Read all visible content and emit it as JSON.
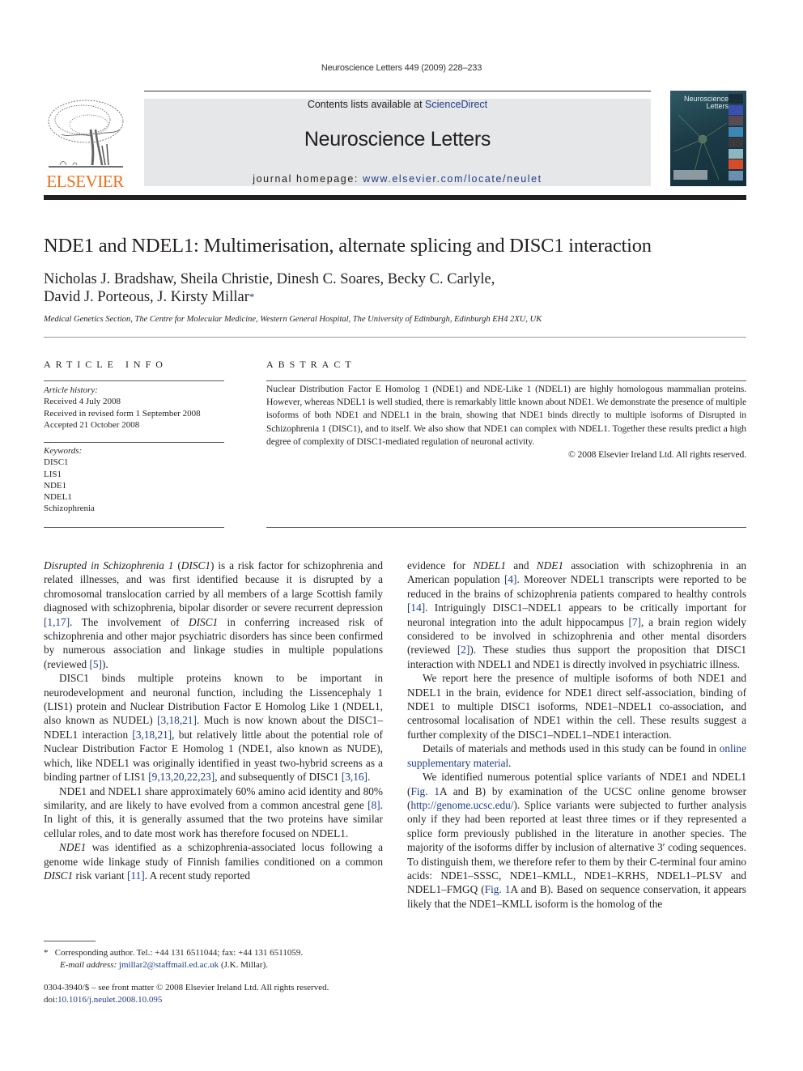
{
  "running_head": "Neuroscience Letters 449 (2009) 228–233",
  "masthead": {
    "publisher": "ELSEVIER",
    "contents_prefix": "Contents lists available at ",
    "contents_link": "ScienceDirect",
    "journal_title": "Neuroscience Letters",
    "homepage_prefix": "journal homepage: ",
    "homepage_link": "www.elsevier.com/locate/neulet",
    "cover_title_line1": "Neuroscience",
    "cover_title_line2": "Letters",
    "accent_color": "#1f3c88",
    "publisher_color": "#e9711c"
  },
  "article": {
    "title": "NDE1 and NDEL1: Multimerisation, alternate splicing and DISC1 interaction",
    "authors_line1": "Nicholas J. Bradshaw, Sheila Christie, Dinesh C. Soares, Becky C. Carlyle,",
    "authors_line2": "David J. Porteous, J. Kirsty Millar",
    "corresponding_marker": "*",
    "affiliation": "Medical Genetics Section, The Centre for Molecular Medicine, Western General Hospital, The University of Edinburgh, Edinburgh EH4 2XU, UK"
  },
  "article_info": {
    "heading": "ARTICLE INFO",
    "history_label": "Article history:",
    "history": [
      "Received 4 July 2008",
      "Received in revised form 1 September 2008",
      "Accepted 21 October 2008"
    ],
    "keywords_label": "Keywords:",
    "keywords": [
      "DISC1",
      "LIS1",
      "NDE1",
      "NDEL1",
      "Schizophrenia"
    ]
  },
  "abstract": {
    "heading": "ABSTRACT",
    "text": "Nuclear Distribution Factor E Homolog 1 (NDE1) and NDE-Like 1 (NDEL1) are highly homologous mammalian proteins. However, whereas NDEL1 is well studied, there is remarkably little known about NDE1. We demonstrate the presence of multiple isoforms of both NDE1 and NDEL1 in the brain, showing that NDE1 binds directly to multiple isoforms of Disrupted in Schizophrenia 1 (DISC1), and to itself. We also show that NDE1 can complex with NDEL1. Together these results predict a high degree of complexity of DISC1-mediated regulation of neuronal activity.",
    "copyright": "© 2008 Elsevier Ireland Ltd. All rights reserved."
  },
  "body": {
    "left": {
      "p1": [
        {
          "t": "Disrupted in Schizophrenia 1",
          "s": "i"
        },
        {
          "t": " ("
        },
        {
          "t": "DISC1",
          "s": "i"
        },
        {
          "t": ") is a risk factor for schizophrenia and related illnesses, and was first identified because it is disrupted by a chromosomal translocation carried by all members of a large Scottish family diagnosed with schizophrenia, bipolar disorder or severe recurrent depression "
        },
        {
          "t": "[1,17]",
          "s": "ref"
        },
        {
          "t": ". The involvement of "
        },
        {
          "t": "DISC1",
          "s": "i"
        },
        {
          "t": " in conferring increased risk of schizophrenia and other major psychiatric disorders has since been confirmed by numerous association and linkage studies in multiple populations (reviewed "
        },
        {
          "t": "[5]",
          "s": "ref"
        },
        {
          "t": ")."
        }
      ],
      "p2": [
        {
          "t": "DISC1 binds multiple proteins known to be important in neurodevelopment and neuronal function, including the Lissencephaly 1 (LIS1) protein and Nuclear Distribution Factor E Homolog Like 1 (NDEL1, also known as NUDEL) "
        },
        {
          "t": "[3,18,21]",
          "s": "ref"
        },
        {
          "t": ". Much is now known about the DISC1–NDEL1 interaction "
        },
        {
          "t": "[3,18,21]",
          "s": "ref"
        },
        {
          "t": ", but relatively little about the potential role of Nuclear Distribution Factor E Homolog 1 (NDE1, also known as NUDE), which, like NDEL1 was originally identified in yeast two-hybrid screens as a binding partner of LIS1 "
        },
        {
          "t": "[9,13,20,22,23]",
          "s": "ref"
        },
        {
          "t": ", and subsequently of DISC1 "
        },
        {
          "t": "[3,16]",
          "s": "ref"
        },
        {
          "t": "."
        }
      ],
      "p3": [
        {
          "t": "NDE1 and NDEL1 share approximately 60% amino acid identity and 80% similarity, and are likely to have evolved from a common ancestral gene "
        },
        {
          "t": "[8]",
          "s": "ref"
        },
        {
          "t": ". In light of this, it is generally assumed that the two proteins have similar cellular roles, and to date most work has therefore focused on NDEL1."
        }
      ],
      "p4": [
        {
          "t": "NDE1",
          "s": "i"
        },
        {
          "t": " was identified as a schizophrenia-associated locus following a genome wide linkage study of Finnish families conditioned on a common "
        },
        {
          "t": "DISC1",
          "s": "i"
        },
        {
          "t": " risk variant "
        },
        {
          "t": "[11]",
          "s": "ref"
        },
        {
          "t": ". A recent study reported"
        }
      ]
    },
    "right": {
      "p1": [
        {
          "t": "evidence for "
        },
        {
          "t": "NDEL1",
          "s": "i"
        },
        {
          "t": " and "
        },
        {
          "t": "NDE1",
          "s": "i"
        },
        {
          "t": " association with schizophrenia in an American population "
        },
        {
          "t": "[4]",
          "s": "ref"
        },
        {
          "t": ". Moreover NDEL1 transcripts were reported to be reduced in the brains of schizophrenia patients compared to healthy controls "
        },
        {
          "t": "[14]",
          "s": "ref"
        },
        {
          "t": ". Intriguingly DISC1–NDEL1 appears to be critically important for neuronal integration into the adult hippocampus "
        },
        {
          "t": "[7]",
          "s": "ref"
        },
        {
          "t": ", a brain region widely considered to be involved in schizophrenia and other mental disorders (reviewed "
        },
        {
          "t": "[2]",
          "s": "ref"
        },
        {
          "t": "). These studies thus support the proposition that DISC1 interaction with NDEL1 and NDE1 is directly involved in psychiatric illness."
        }
      ],
      "p2": [
        {
          "t": "We report here the presence of multiple isoforms of both NDE1 and NDEL1 in the brain, evidence for NDE1 direct self-association, binding of NDE1 to multiple DISC1 isoforms, NDE1–NDEL1 co-association, and centrosomal localisation of NDE1 within the cell. These results suggest a further complexity of the DISC1–NDEL1–NDE1 interaction."
        }
      ],
      "p3": [
        {
          "t": "Details of materials and methods used in this study can be found in "
        },
        {
          "t": "online supplementary material",
          "s": "ref"
        },
        {
          "t": "."
        }
      ],
      "p4": [
        {
          "t": "We identified numerous potential splice variants of NDE1 and NDEL1 ("
        },
        {
          "t": "Fig. 1",
          "s": "ref"
        },
        {
          "t": "A and B) by examination of the UCSC online genome browser ("
        },
        {
          "t": "http://genome.ucsc.edu/",
          "s": "ref"
        },
        {
          "t": "). Splice variants were subjected to further analysis only if they had been reported at least three times or if they represented a splice form previously published in the literature in another species. The majority of the isoforms differ by inclusion of alternative 3′ coding sequences. To distinguish them, we therefore refer to them by their C-terminal four amino acids: NDE1–SSSC, NDE1–KMLL, NDE1–KRHS, NDEL1–PLSV and NDEL1–FMGQ ("
        },
        {
          "t": "Fig. 1",
          "s": "ref"
        },
        {
          "t": "A and B). Based on sequence conservation, it appears likely that the NDE1–KMLL isoform is the homolog of the"
        }
      ]
    }
  },
  "footnote": {
    "marker": "*",
    "line1": "Corresponding author. Tel.: +44 131 6511044; fax: +44 131 6511059.",
    "email_label": "E-mail address: ",
    "email": "jmillar2@staffmail.ed.ac.uk",
    "email_suffix": " (J.K. Millar)."
  },
  "footer": {
    "issn_line": "0304-3940/$ – see front matter © 2008 Elsevier Ireland Ltd. All rights reserved.",
    "doi_prefix": "doi:",
    "doi": "10.1016/j.neulet.2008.10.095"
  }
}
